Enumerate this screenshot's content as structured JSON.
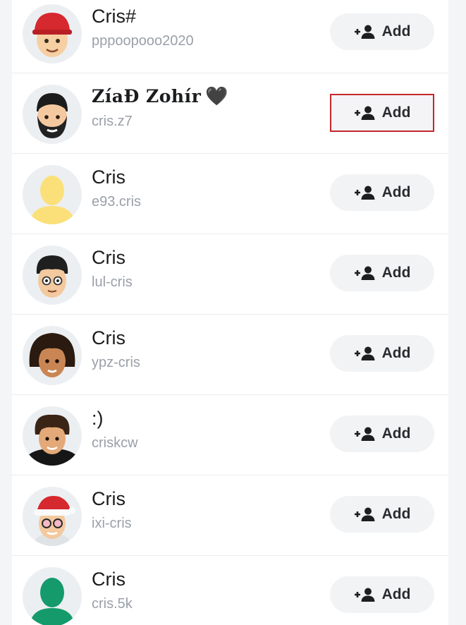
{
  "colors": {
    "accent_outline": "#c4262b",
    "username": "#9aa0a8",
    "button_bg": "#f2f3f5"
  },
  "results": [
    {
      "name": "Cris#",
      "username": "pppoopooo2020",
      "add_label": "Add",
      "avatar_icon": "bitmoji-red-cap-icon",
      "highlighted": false
    },
    {
      "name": "ZíaĐ Zohír",
      "name_suffix": "🖤",
      "username": "cris.z7",
      "add_label": "Add",
      "avatar_icon": "bitmoji-beard-icon",
      "highlighted": true
    },
    {
      "name": "Cris",
      "username": "e93.cris",
      "add_label": "Add",
      "avatar_icon": "yellow-silhouette-icon",
      "highlighted": false
    },
    {
      "name": "Cris",
      "username": "lul-cris",
      "add_label": "Add",
      "avatar_icon": "bitmoji-glasses-icon",
      "highlighted": false
    },
    {
      "name": "Cris",
      "username": "ypz-cris",
      "add_label": "Add",
      "avatar_icon": "bitmoji-dreadlocks-icon",
      "highlighted": false
    },
    {
      "name": ":)",
      "username": "criskcw",
      "add_label": "Add",
      "avatar_icon": "bitmoji-curly-hair-icon",
      "highlighted": false
    },
    {
      "name": "Cris",
      "username": "ixi-cris",
      "add_label": "Add",
      "avatar_icon": "bitmoji-santa-hat-icon",
      "highlighted": false
    },
    {
      "name": "Cris",
      "username": "cris.5k",
      "add_label": "Add",
      "avatar_icon": "green-silhouette-icon",
      "highlighted": false
    }
  ]
}
